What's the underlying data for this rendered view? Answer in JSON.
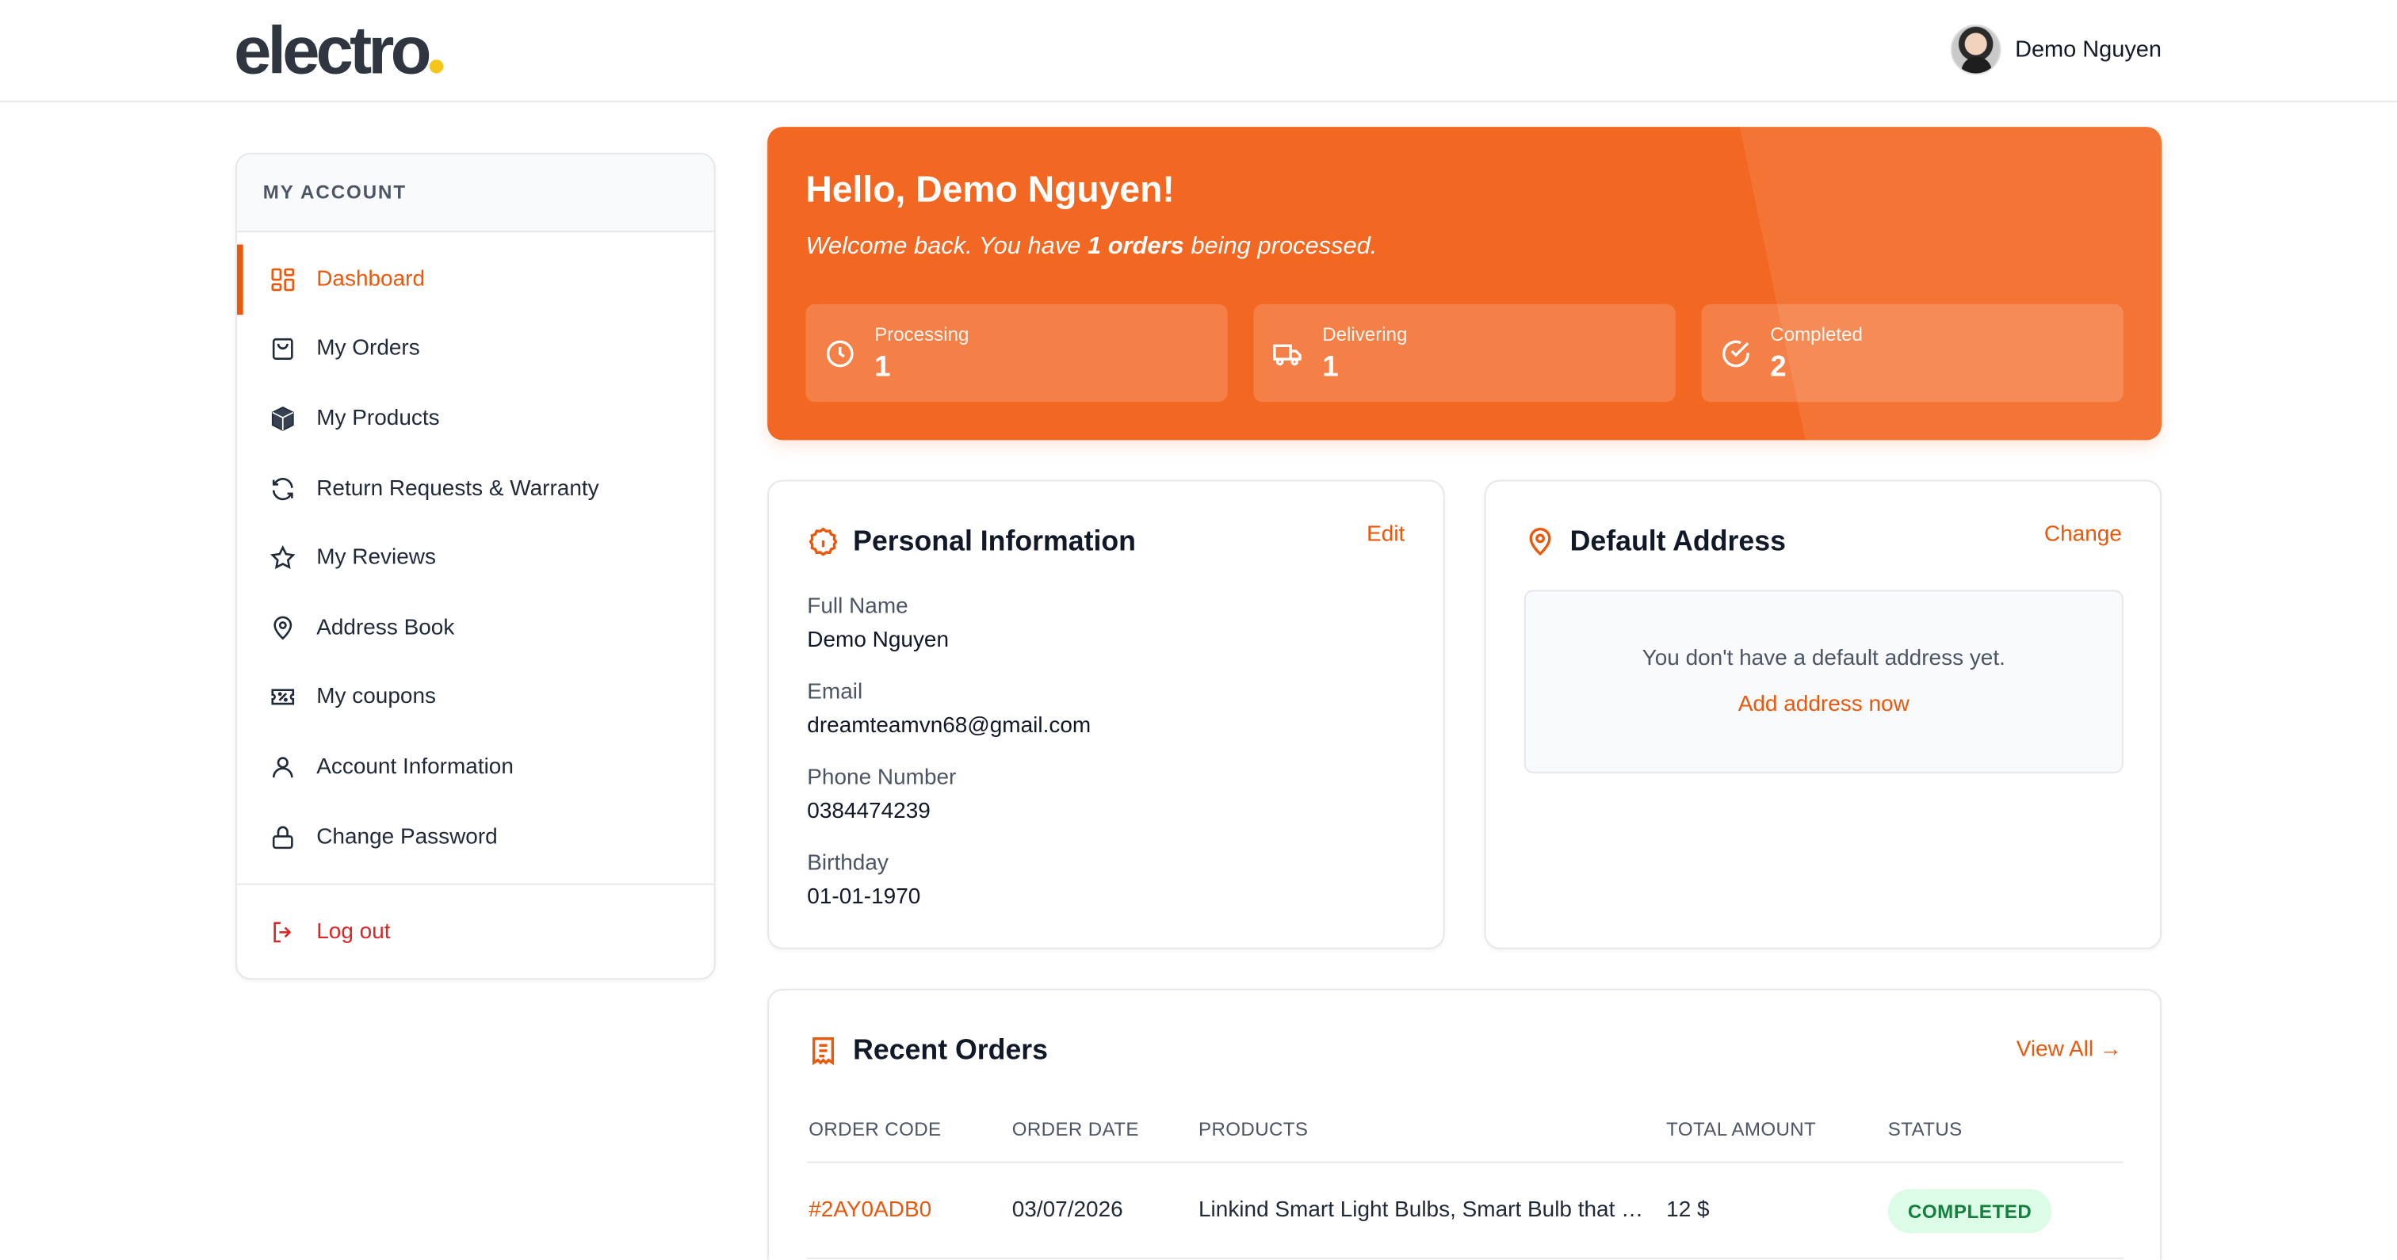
{
  "brand": {
    "logo_text": "electro"
  },
  "user": {
    "name": "Demo Nguyen"
  },
  "sidebar": {
    "heading": "MY ACCOUNT",
    "items": [
      {
        "label": "Dashboard",
        "icon": "dashboard-icon",
        "active": true
      },
      {
        "label": "My Orders",
        "icon": "shopping-bag-icon"
      },
      {
        "label": "My Products",
        "icon": "box-icon"
      },
      {
        "label": "Return Requests & Warranty",
        "icon": "refresh-icon"
      },
      {
        "label": "My Reviews",
        "icon": "star-icon"
      },
      {
        "label": "Address Book",
        "icon": "map-pin-icon"
      },
      {
        "label": "My coupons",
        "icon": "coupon-icon"
      },
      {
        "label": "Account Information",
        "icon": "user-icon"
      },
      {
        "label": "Change Password",
        "icon": "lock-icon"
      }
    ],
    "logout_label": "Log out"
  },
  "hero": {
    "greeting": "Hello, Demo Nguyen!",
    "sub_prefix": "Welcome back. You have ",
    "sub_bold": "1 orders",
    "sub_suffix": " being processed.",
    "stats": [
      {
        "label": "Processing",
        "value": "1",
        "icon": "clock-icon"
      },
      {
        "label": "Delivering",
        "value": "1",
        "icon": "truck-icon"
      },
      {
        "label": "Completed",
        "value": "2",
        "icon": "check-circle-icon"
      }
    ]
  },
  "personal": {
    "title": "Personal Information",
    "edit_label": "Edit",
    "fields": [
      {
        "label": "Full Name",
        "value": "Demo Nguyen"
      },
      {
        "label": "Email",
        "value": "dreamteamvn68@gmail.com"
      },
      {
        "label": "Phone Number",
        "value": "0384474239"
      },
      {
        "label": "Birthday",
        "value": "01-01-1970"
      }
    ]
  },
  "address": {
    "title": "Default Address",
    "change_label": "Change",
    "empty_text": "You don't have a default address yet.",
    "add_label": "Add address now"
  },
  "orders": {
    "title": "Recent Orders",
    "view_all_label": "View All →",
    "columns": [
      "ORDER CODE",
      "ORDER DATE",
      "PRODUCTS",
      "TOTAL AMOUNT",
      "STATUS"
    ],
    "rows": [
      {
        "code": "#2AY0ADB0",
        "date": "03/07/2026",
        "products": "Linkind Smart Light Bulbs, Smart Bulb that Work with Alexa & Google Home",
        "total": "12 $",
        "status": "COMPLETED"
      }
    ]
  },
  "colors": {
    "accent": "#f26722",
    "success_bg": "#dcfce7",
    "success_text": "#15803d",
    "danger": "#dc2626"
  }
}
